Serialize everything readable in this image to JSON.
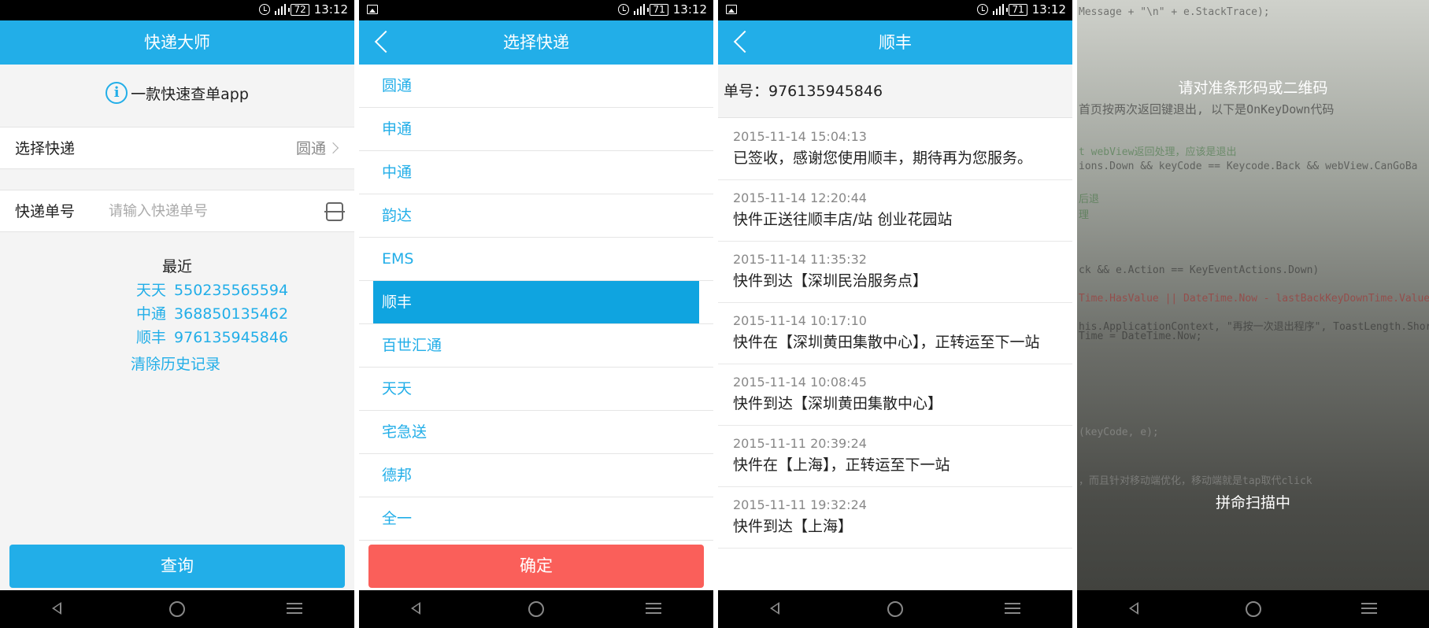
{
  "screen1": {
    "status": {
      "battery": "72",
      "time": "13:12"
    },
    "title": "快递大师",
    "info_text": "一款快速查单app",
    "info_icon": "info-icon",
    "choose_label": "选择快递",
    "choose_value": "圆通",
    "tracking_label": "快递单号",
    "tracking_placeholder": "请输入快递单号",
    "recent_title": "最近",
    "recent": [
      {
        "carrier": "天天",
        "number": "550235565594"
      },
      {
        "carrier": "中通",
        "number": "368850135462"
      },
      {
        "carrier": "顺丰",
        "number": "976135945846"
      }
    ],
    "clear_history": "清除历史记录",
    "query_button": "查询"
  },
  "screen2": {
    "status": {
      "battery": "71",
      "time": "13:12"
    },
    "title": "选择快递",
    "carriers": [
      "圆通",
      "申通",
      "中通",
      "韵达",
      "EMS",
      "顺丰",
      "百世汇通",
      "天天",
      "宅急送",
      "德邦",
      "全一"
    ],
    "selected": "顺丰",
    "confirm_button": "确定"
  },
  "screen3": {
    "status": {
      "battery": "71",
      "time": "13:12"
    },
    "title": "顺丰",
    "order_label": "单号：976135945846",
    "events": [
      {
        "time": "2015-11-14 15:04:13",
        "desc": "已签收，感谢您使用顺丰，期待再为您服务。"
      },
      {
        "time": "2015-11-14 12:20:44",
        "desc": "快件正送往顺丰店/站 创业花园站"
      },
      {
        "time": "2015-11-14 11:35:32",
        "desc": "快件到达【深圳民治服务点】"
      },
      {
        "time": "2015-11-14 10:17:10",
        "desc": "快件在【深圳黄田集散中心】，正转运至下一站"
      },
      {
        "time": "2015-11-14 10:08:45",
        "desc": "快件到达【深圳黄田集散中心】"
      },
      {
        "time": "2015-11-11 20:39:24",
        "desc": "快件在【上海】，正转运至下一站"
      },
      {
        "time": "2015-11-11 19:32:24",
        "desc": "快件到达【上海】"
      }
    ]
  },
  "screen4": {
    "scan_hint": "请对准条形码或二维码",
    "scan_status": "拼命扫描中",
    "camera_text": [
      "Message + \"\\n\" + e.StackTrace);",
      "首页按两次返回键退出, 以下是OnKeyDown代码",
      "t webView返回处理，应该是退出",
      "ions.Down && keyCode == Keycode.Back && webView.CanGoBa",
      "后退",
      "理",
      "ck && e.Action == KeyEventActions.Down)",
      "Time.HasValue || DateTime.Now - lastBackKeyDownTime.Value >",
      "his.ApplicationContext, \"再按一次退出程序\", ToastLength.Short).",
      "Time = DateTime.Now;",
      "(keyCode, e);",
      "，而且针对移动端优化，移动端就是tap取代click"
    ]
  }
}
